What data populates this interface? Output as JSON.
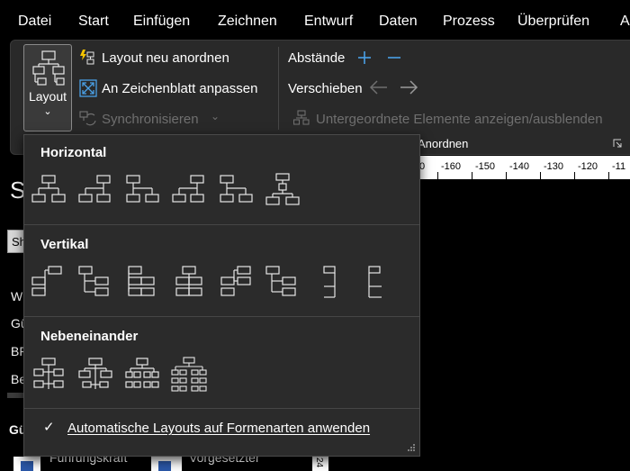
{
  "menubar": {
    "items": [
      "Datei",
      "Start",
      "Einfügen",
      "Zeichnen",
      "Entwurf",
      "Daten",
      "Prozess",
      "Überprüfen",
      "A"
    ]
  },
  "ribbon": {
    "layout_button_label": "Layout",
    "layout_neu": "Layout neu anordnen",
    "an_zeichenblatt": "An Zeichenblatt anpassen",
    "synchronisieren": "Synchronisieren",
    "abstaende": "Abstände",
    "verschieben": "Verschieben",
    "untergeordnete": "Untergeordnete Elemente anzeigen/ausblenden",
    "group_label": "Anordnen"
  },
  "ruler": {
    "labels": [
      "0",
      "-160",
      "-150",
      "-140",
      "-130",
      "-120",
      "-11"
    ]
  },
  "background": {
    "big_letter": "S",
    "box_text": "Sh",
    "side_letters": [
      "W",
      "Gü",
      "BF",
      "Be"
    ],
    "bottom_label": "Gü",
    "card1": "Führungskraft",
    "card2": "Vorgesetzter",
    "vertical_num": "24"
  },
  "dropdown": {
    "sections": {
      "horizontal": "Horizontal",
      "vertical": "Vertikal",
      "side_by_side": "Nebeneinander"
    },
    "auto_layout_label": "Automatische Layouts auf Formenarten anwenden"
  }
}
